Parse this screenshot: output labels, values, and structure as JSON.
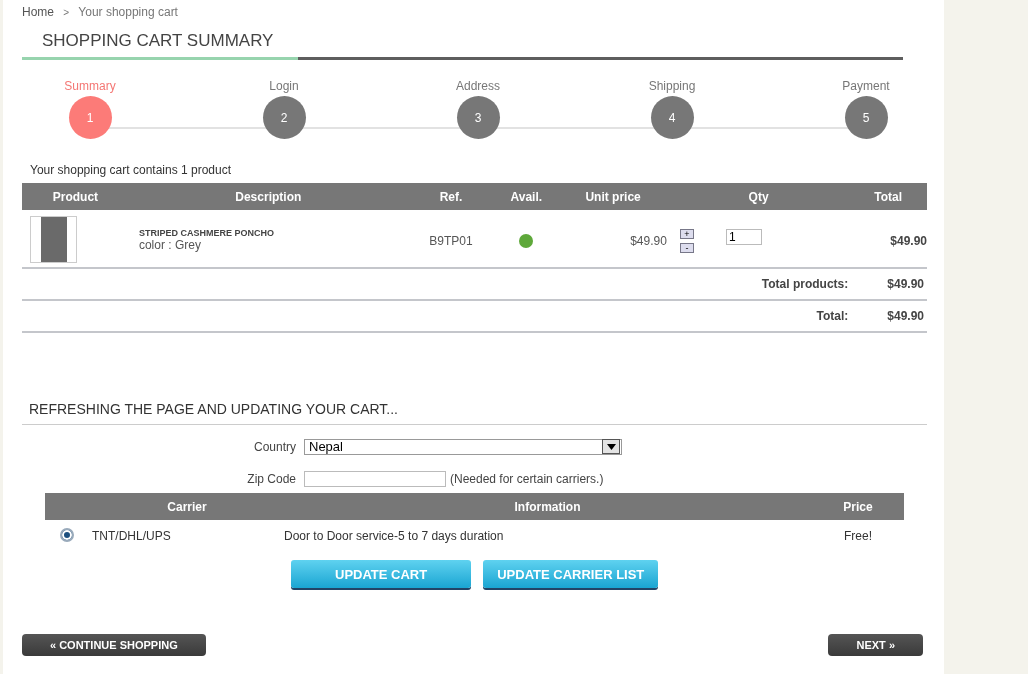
{
  "breadcrumb": {
    "home": "Home",
    "separator": ">",
    "current": "Your shopping cart"
  },
  "heading": "SHOPPING CART SUMMARY",
  "steps": [
    {
      "label": "Summary",
      "number": "1",
      "selected": true
    },
    {
      "label": "Login",
      "number": "2",
      "selected": false
    },
    {
      "label": "Address",
      "number": "3",
      "selected": false
    },
    {
      "label": "Shipping",
      "number": "4",
      "selected": false
    },
    {
      "label": "Payment",
      "number": "5",
      "selected": false
    }
  ],
  "cart_count": "Your shopping cart contains 1 product",
  "cart_table": {
    "columns": [
      "Product",
      "Description",
      "Ref.",
      "Avail.",
      "Unit price",
      "Qty",
      "Total"
    ],
    "rows": [
      {
        "name": "STRIPED CASHMERE PONCHO",
        "attributes": "color : Grey",
        "ref": "B9TP01",
        "in_stock": true,
        "unit_price": "$49.90",
        "increase": "+",
        "decrease": "-",
        "qty": "1",
        "total": "$49.90"
      }
    ],
    "summary": [
      {
        "label": "Total products:",
        "value": "$49.90"
      },
      {
        "label": "Total:",
        "value": "$49.90"
      }
    ]
  },
  "shipping": {
    "heading": "REFRESHING THE PAGE AND UPDATING YOUR CART...",
    "country_label": "Country",
    "country": "Nepal",
    "zip_label": "Zip Code",
    "zip_note": "(Needed for certain carriers.)",
    "columns": [
      "Carrier",
      "Information",
      "Price"
    ],
    "carriers": [
      {
        "name": "TNT/DHL/UPS",
        "information": "Door to Door service-5 to 7 days duration",
        "price": "Free!",
        "selected": true
      }
    ],
    "buttons": [
      "UPDATE CART",
      "UPDATE CARRIER LIST"
    ]
  },
  "footer_buttons": {
    "back": "« CONTINUE SHOPPING",
    "next": "NEXT »"
  }
}
